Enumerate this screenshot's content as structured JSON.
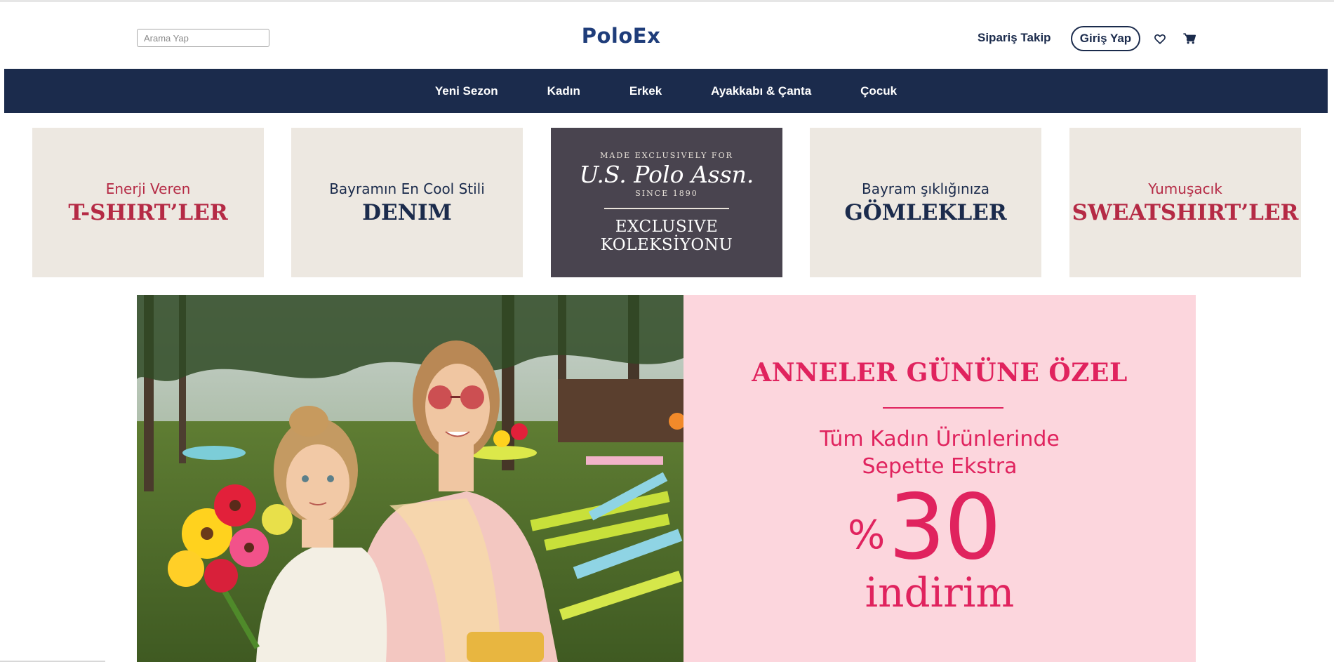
{
  "header": {
    "search_placeholder": "Arama Yap",
    "logo": "PoloEx",
    "order_tracking": "Sipariş Takip",
    "login": "Giriş Yap",
    "icons": [
      "heart-icon",
      "cart-icon"
    ]
  },
  "nav": {
    "items": [
      "Yeni Sezon",
      "Kadın",
      "Erkek",
      "Ayakkabı & Çanta",
      "Çocuk"
    ]
  },
  "categories": [
    {
      "subtitle": "Enerji Veren",
      "title": "T-SHIRT’LER",
      "color": "#b52a45"
    },
    {
      "subtitle": "Bayramın En Cool Stili",
      "title": "DENIM",
      "color": "#1b2b4c"
    },
    {
      "exclusive": true,
      "small_top": "MADE EXCLUSIVELY FOR",
      "brand": "U.S. Polo Assn.",
      "since": "SINCE 1890",
      "title_line1": "EXCLUSIVE",
      "title_line2": "KOLEKSİYONU"
    },
    {
      "subtitle": "Bayram şıklığınıza",
      "title": "GÖMLEKLER",
      "color": "#1b2b4c"
    },
    {
      "subtitle": "Yumuşacık",
      "title": "SWEATSHIRT’LER",
      "color": "#b52a45"
    }
  ],
  "promo": {
    "title": "ANNELER GÜNÜNE ÖZEL",
    "line1": "Tüm Kadın Ürünlerinde",
    "line2": "Sepette Ekstra",
    "percent_sign": "%",
    "value": "30",
    "discount_word": "indirim"
  },
  "colors": {
    "navy": "#1b2b4c",
    "logo_blue": "#1f3d7a",
    "promo_pink": "#e0235e",
    "promo_bg": "#fcd6dd",
    "tile_bg": "#ede8e1",
    "tile_dark": "#49444f",
    "tile_red": "#b52a45"
  }
}
